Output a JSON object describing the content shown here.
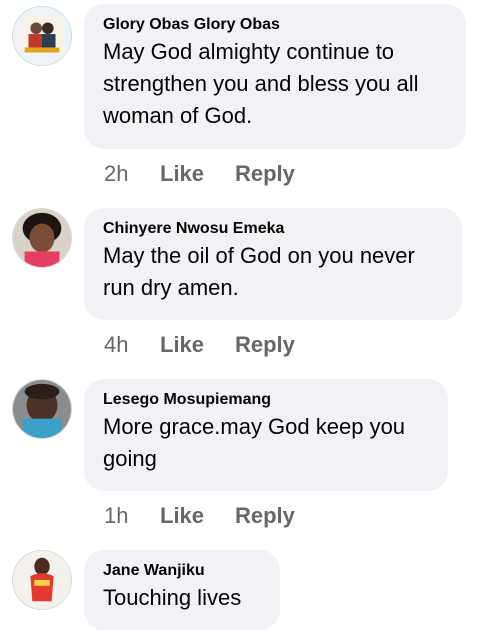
{
  "comments": [
    {
      "author": "Glory Obas Glory Obas",
      "text": "May God almighty continue to\nstrengthen you and bless you all\nwoman of God.",
      "time": "2h",
      "like": "Like",
      "reply": "Reply"
    },
    {
      "author": "Chinyere Nwosu Emeka",
      "text": "May the oil of God on you never\nrun dry amen.",
      "time": "4h",
      "like": "Like",
      "reply": "Reply"
    },
    {
      "author": "Lesego Mosupiemang",
      "text": "More grace.may God keep you\ngoing",
      "time": "1h",
      "like": "Like",
      "reply": "Reply"
    },
    {
      "author": "Jane Wanjiku",
      "text": "Touching lives"
    }
  ],
  "colors": {
    "bubble": "#f0f2f5",
    "meta_text": "#65676b",
    "author_text": "#050505"
  }
}
